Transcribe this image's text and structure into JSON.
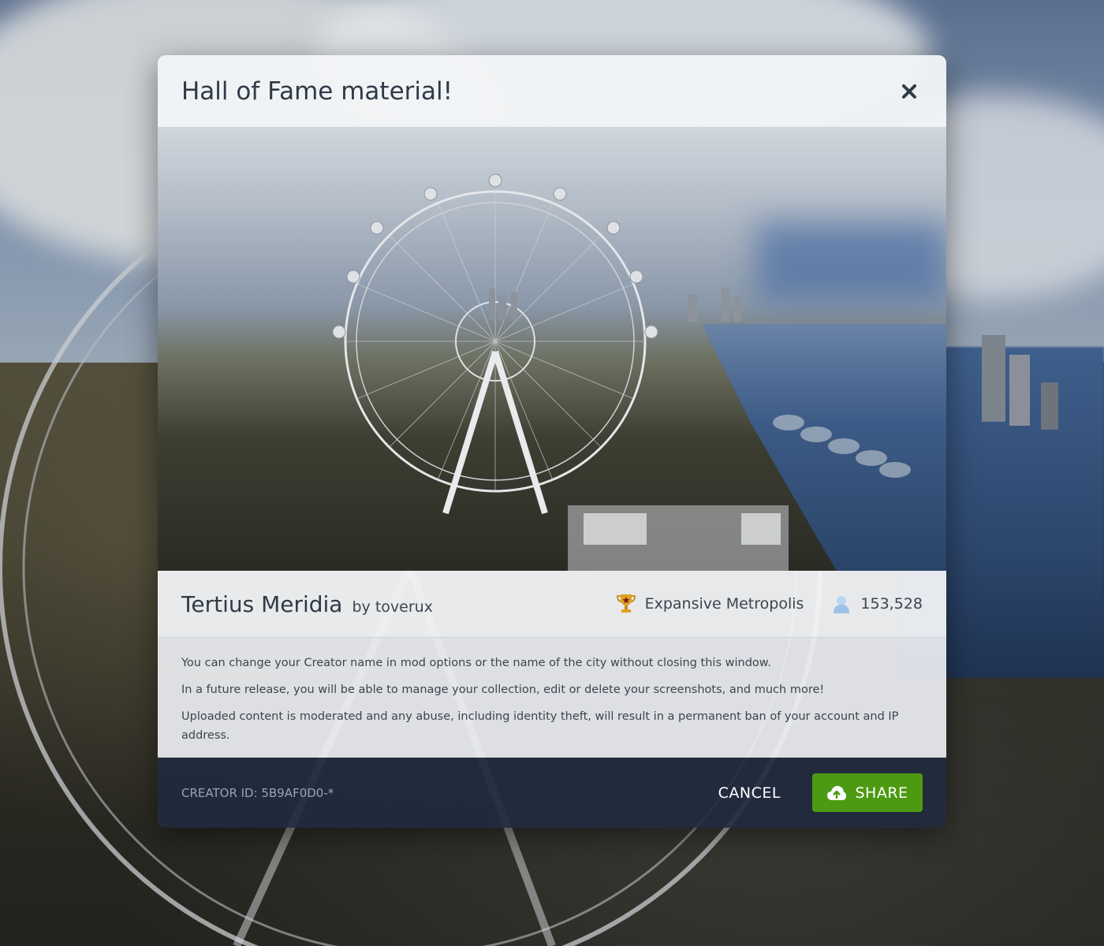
{
  "dialog": {
    "title": "Hall of Fame material!",
    "close_icon": "close-icon"
  },
  "city": {
    "name": "Tertius Meridia",
    "by_creator": "by toverux",
    "achievement": "Expansive Metropolis",
    "achievement_icon": "trophy-icon",
    "population": "153,528",
    "population_icon": "population-icon"
  },
  "notes": [
    "You can change your Creator name in mod options or the name of the city without closing this window.",
    "In a future release, you will be able to manage your collection, edit or delete your screenshots, and much more!",
    "Uploaded content is moderated and any abuse, including identity theft, will result in a permanent ban of your account and IP address."
  ],
  "footer": {
    "creator_id": "CREATOR ID: 5B9AF0D0-*",
    "cancel_label": "CANCEL",
    "share_label": "SHARE",
    "share_icon": "cloud-upload-icon"
  },
  "colors": {
    "share_button": "#4d9a12",
    "footer_bg": "#202a3e",
    "panel_bg": "#f2f4f7"
  }
}
